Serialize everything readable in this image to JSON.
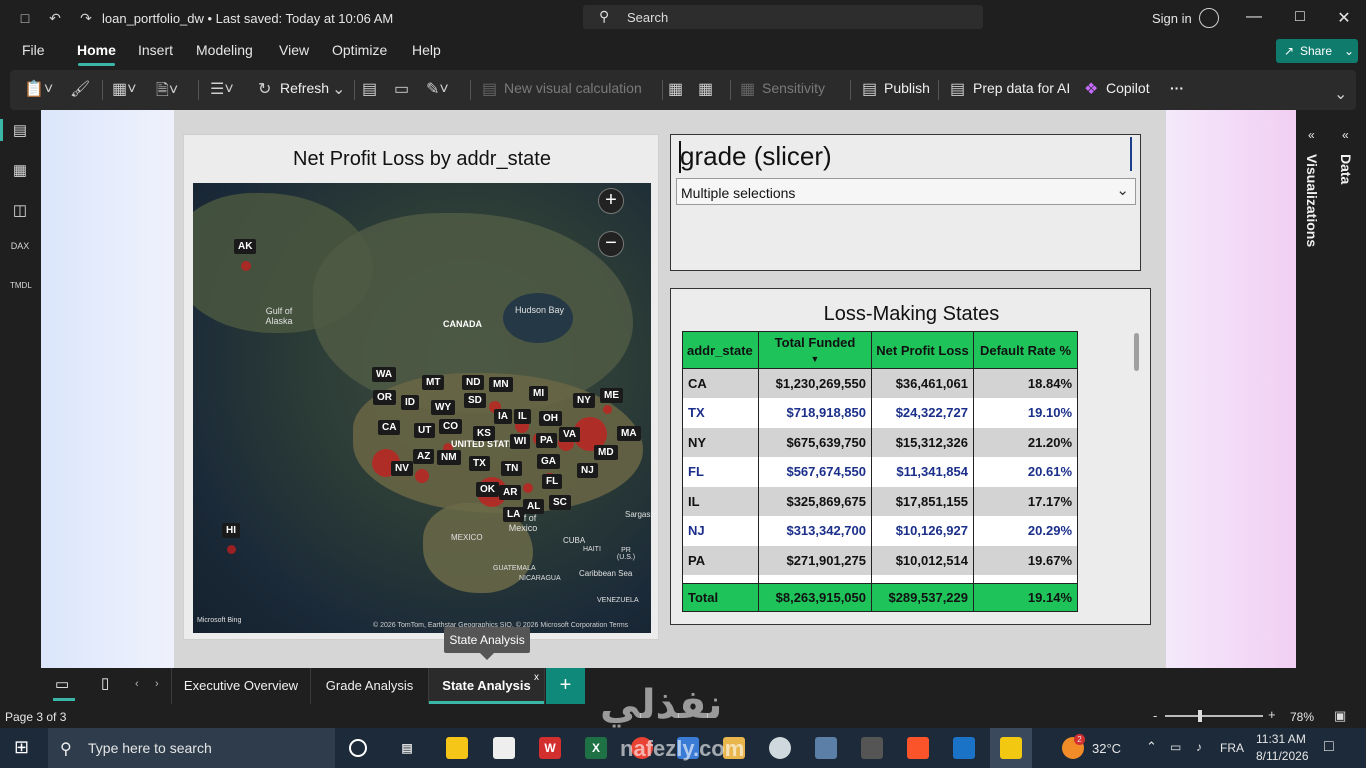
{
  "window": {
    "file_title": "loan_portfolio_dw • Last saved: Today at 10:06 AM",
    "search_placeholder": "Search",
    "signin": "Sign in"
  },
  "menu": {
    "items": [
      "File",
      "Home",
      "Insert",
      "Modeling",
      "View",
      "Optimize",
      "Help"
    ],
    "active": "Home",
    "share": "Share"
  },
  "ribbon": {
    "refresh": "Refresh",
    "new_visual_calc": "New visual calculation",
    "sensitivity": "Sensitivity",
    "publish": "Publish",
    "prep_data": "Prep data for AI",
    "copilot": "Copilot",
    "more": "···"
  },
  "right_panel": {
    "visualizations": "Visualizations",
    "data": "Data"
  },
  "map_visual": {
    "title": "Net Profit Loss by addr_state",
    "labels": {
      "canada": "CANADA",
      "hudson_bay": "Hudson Bay",
      "gulf_alaska": "Gulf of Alaska",
      "united_states": "UNITED STATES",
      "gulf_mexico": "Gulf of Mexico",
      "mexico": "MEXICO",
      "cuba": "CUBA",
      "haiti": "HAITI",
      "pr": "PR (U.S.)",
      "guatemala": "GUATEMALA",
      "nicaragua": "NICARAGUA",
      "caribbean": "Caribbean Sea",
      "venezuela": "VENEZUELA",
      "sargasso": "Sargasso",
      "bing": "Microsoft Bing",
      "credit": "© 2026 TomTom, Earthstar Geographics SIO, © 2026 Microsoft Corporation Terms"
    },
    "states": [
      "AK",
      "HI",
      "WA",
      "OR",
      "ID",
      "MT",
      "ND",
      "MN",
      "MI",
      "NY",
      "ME",
      "CA",
      "NV",
      "UT",
      "WY",
      "SD",
      "IA",
      "IL",
      "OH",
      "CO",
      "KS",
      "WI",
      "PA",
      "VA",
      "MA",
      "AZ",
      "NM",
      "TX",
      "TN",
      "GA",
      "MD",
      "NJ",
      "OK",
      "AR",
      "FL",
      "SC",
      "AL",
      "LA"
    ]
  },
  "slicer": {
    "title": "grade (slicer)",
    "value": "Multiple selections"
  },
  "table_visual": {
    "title": "Loss-Making States",
    "columns": [
      "addr_state",
      "Total Funded",
      "Net Profit Loss",
      "Default Rate %"
    ],
    "rows": [
      [
        "CA",
        "$1,230,269,550",
        "$36,461,061",
        "18.84%"
      ],
      [
        "TX",
        "$718,918,850",
        "$24,322,727",
        "19.10%"
      ],
      [
        "NY",
        "$675,639,750",
        "$15,312,326",
        "21.20%"
      ],
      [
        "FL",
        "$567,674,550",
        "$11,341,854",
        "20.61%"
      ],
      [
        "IL",
        "$325,869,675",
        "$17,851,155",
        "17.17%"
      ],
      [
        "NJ",
        "$313,342,700",
        "$10,126,927",
        "20.29%"
      ],
      [
        "PA",
        "$271,901,275",
        "$10,012,514",
        "19.67%"
      ]
    ],
    "total": [
      "Total",
      "$8,263,915,050",
      "$289,537,229",
      "19.14%"
    ]
  },
  "tooltip": "State Analysis",
  "tabs": [
    "Executive Overview",
    "Grade Analysis",
    "State Analysis"
  ],
  "active_tab": "State Analysis",
  "status": {
    "page": "Page 3 of 3",
    "zoom": "78%"
  },
  "taskbar": {
    "search_placeholder": "Type here to search",
    "temperature": "32°C",
    "language": "FRA",
    "time": "11:31 AM",
    "date": "8/11/2026",
    "notif_count": "2"
  },
  "watermark": {
    "arabic": "نفذلي",
    "latin": "nafezly.com"
  },
  "colors": {
    "accent_teal": "#3bb7a8",
    "table_header_green": "#1ec45a",
    "bubble_red": "#c81e1e"
  }
}
